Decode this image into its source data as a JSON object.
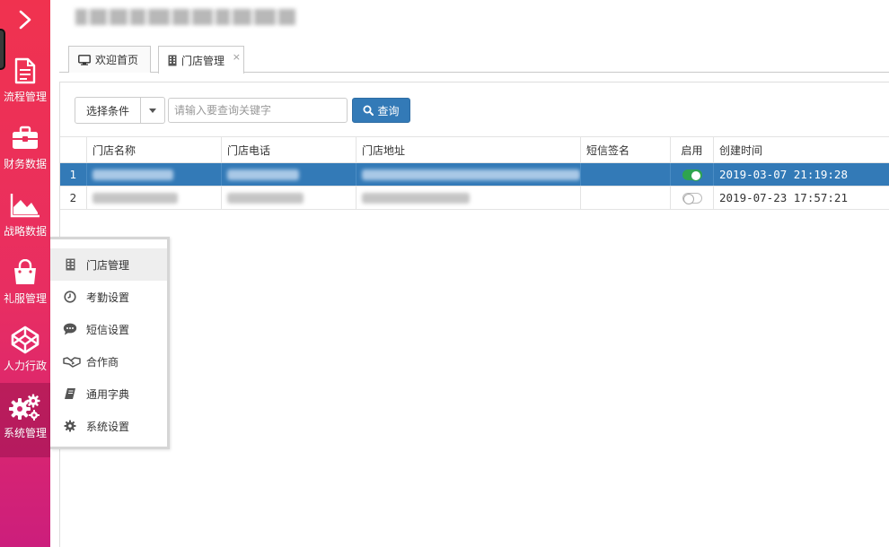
{
  "header": {
    "title": ""
  },
  "rail": {
    "items": [
      {
        "label": "流程管理",
        "icon": "document-icon"
      },
      {
        "label": "财务数据",
        "icon": "briefcase-icon"
      },
      {
        "label": "战略数据",
        "icon": "area-chart-icon"
      },
      {
        "label": "礼服管理",
        "icon": "shopping-bag-icon"
      },
      {
        "label": "人力行政",
        "icon": "codepen-icon"
      },
      {
        "label": "系统管理",
        "icon": "gears-icon"
      }
    ],
    "active": "系统管理"
  },
  "tabs": [
    {
      "label": "欢迎首页",
      "icon": "monitor-icon",
      "active": false
    },
    {
      "label": "门店管理",
      "icon": "building-icon",
      "active": true,
      "close": "×"
    }
  ],
  "filter": {
    "condition_label": "选择条件",
    "search_placeholder": "请输入要查询关键字",
    "search_value": "",
    "query_label": "查询"
  },
  "table": {
    "columns": [
      "门店名称",
      "门店电话",
      "门店地址",
      "短信签名",
      "启用",
      "创建时间"
    ],
    "rows": [
      {
        "index": "1",
        "enabled": true,
        "created": "2019-03-07 21:19:28",
        "selected": true
      },
      {
        "index": "2",
        "enabled": false,
        "created": "2019-07-23 17:57:21",
        "selected": false
      }
    ]
  },
  "flyout": {
    "items": [
      {
        "label": "门店管理",
        "icon": "building-icon",
        "active": true
      },
      {
        "label": "考勤设置",
        "icon": "clock-icon",
        "active": false
      },
      {
        "label": "短信设置",
        "icon": "comment-icon",
        "active": false
      },
      {
        "label": "合作商",
        "icon": "handshake-icon",
        "active": false
      },
      {
        "label": "通用字典",
        "icon": "book-icon",
        "active": false
      },
      {
        "label": "系统设置",
        "icon": "gear-icon",
        "active": false
      }
    ]
  },
  "colors": {
    "rail_top": "#f0324f",
    "rail_bottom": "#cc1e7c",
    "primary": "#337ab7",
    "switch_on": "#2ea44f"
  }
}
